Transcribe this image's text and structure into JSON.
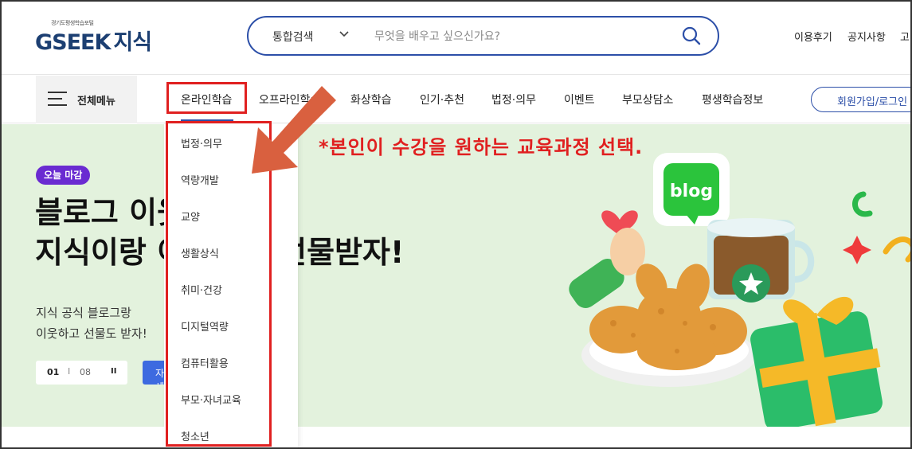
{
  "header": {
    "logo_sub": "경기도평생학습포털",
    "logo_main": "GSEEK",
    "logo_suffix": "지식",
    "search": {
      "category": "통합검색",
      "placeholder": "무엇을 배우고 싶으신가요?"
    },
    "utility_links": [
      "이용후기",
      "공지사항",
      "고"
    ]
  },
  "nav": {
    "all_menu_label": "전체메뉴",
    "items": [
      "온라인학습",
      "오프라인학습",
      "화상학습",
      "인기·추천",
      "법정·의무",
      "이벤트",
      "부모상담소",
      "평생학습정보"
    ],
    "active_index": 0,
    "join_label": "회원가입/로그인"
  },
  "dropdown": {
    "items": [
      "법정·의무",
      "역량개발",
      "교양",
      "생활상식",
      "취미·건강",
      "디지털역량",
      "컴퓨터활용",
      "부모·자녀교육",
      "청소년"
    ]
  },
  "banner": {
    "badge": "오늘 마감",
    "headline_line1": "블로그 이웃 이벤트",
    "headline_line2": "지식이랑 이웃하고 선물받자!",
    "sub_line1": "지식 공식 블로그랑",
    "sub_line2": "이웃하고 선물도 받자!",
    "pager_current": "01",
    "pager_sep": "I",
    "pager_total": "08",
    "pager_pause": "II",
    "more_label": "자세히"
  },
  "illustration": {
    "blog_label": "blog"
  },
  "annotation": {
    "note": "*본인이 수강을 원하는 교육과정 선택."
  },
  "colors": {
    "brand_blue": "#2c4fa8",
    "highlight_red": "#e02020",
    "banner_bg": "#e3f2dd",
    "badge_purple": "#6a2bd1",
    "arrow_orange": "#d9603f"
  }
}
